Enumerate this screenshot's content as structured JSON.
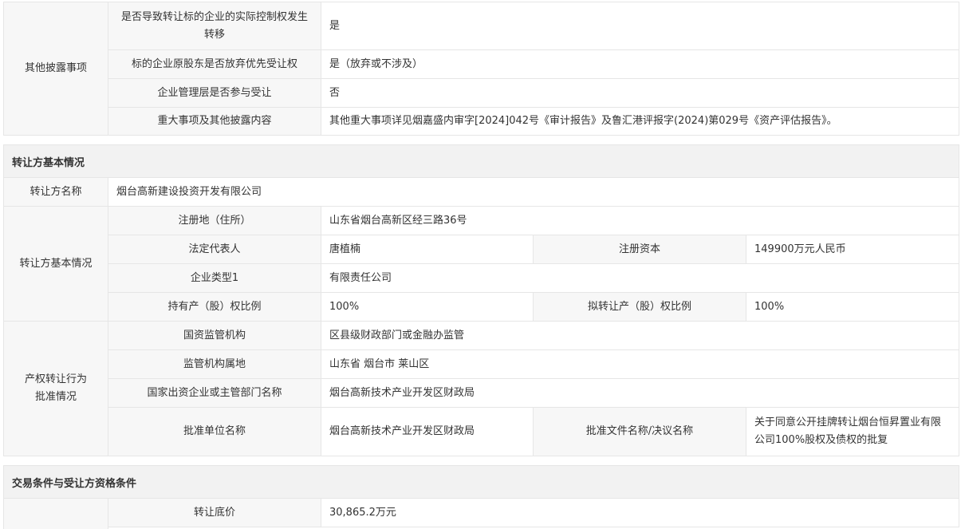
{
  "other_disclosure": {
    "group_label": "其他披露事项",
    "rows": [
      {
        "label": "是否导致转让标的企业的实际控制权发生转移",
        "value": "是"
      },
      {
        "label": "标的企业原股东是否放弃优先受让权",
        "value": "是（放弃或不涉及）"
      },
      {
        "label": "企业管理层是否参与受让",
        "value": "否"
      },
      {
        "label": "重大事项及其他披露内容",
        "value": "其他重大事项详见烟嘉盛内审字[2024]042号《审计报告》及鲁汇港评报字(2024)第029号《资产评估报告》。"
      }
    ]
  },
  "transferor": {
    "section_title": "转让方基本情况",
    "name_label": "转让方名称",
    "name_value": "烟台高新建设投资开发有限公司",
    "basic_group_label": "转让方基本情况",
    "address_label": "注册地（住所）",
    "address_value": "山东省烟台高新区经三路36号",
    "legal_rep_label": "法定代表人",
    "legal_rep_value": "唐植楠",
    "capital_label": "注册资本",
    "capital_value": "149900万元人民币",
    "type_label": "企业类型1",
    "type_value": "有限责任公司",
    "holding_label": "持有产（股）权比例",
    "holding_value": "100%",
    "planned_label": "拟转让产（股）权比例",
    "planned_value": "100%"
  },
  "approval": {
    "group_label_line1": "产权转让行为",
    "group_label_line2": "批准情况",
    "regulator_label": "国资监管机构",
    "regulator_value": "区县级财政部门或金融办监管",
    "location_label": "监管机构属地",
    "location_value": "山东省 烟台市 莱山区",
    "dept_label": "国家出资企业或主管部门名称",
    "dept_value": "烟台高新技术产业开发区财政局",
    "unit_label": "批准单位名称",
    "unit_value": "烟台高新技术产业开发区财政局",
    "doc_label": "批准文件名称/决议名称",
    "doc_value": "关于同意公开挂牌转让烟台恒昇置业有限公司100%股权及债权的批复"
  },
  "conditions": {
    "section_title": "交易条件与受让方资格条件",
    "price_label": "转让底价",
    "price_value": "30,865.2万元"
  }
}
